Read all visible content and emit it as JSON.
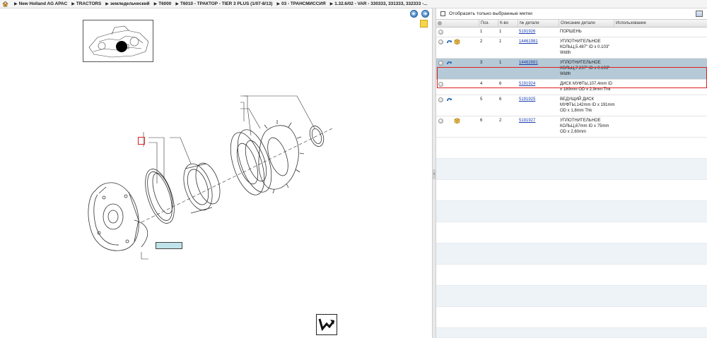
{
  "breadcrumb": [
    "New Holland AG APAC",
    "TRACTORS",
    "земледельческий",
    "T6000",
    "T6010 - ТРАКТОР - TIER 3 PLUS (1/07-8/13)",
    "03 - ТРАНСМИССИЯ",
    "1.32.6/02 - VAR - 330333, 331333, 332333 -..."
  ],
  "filter": {
    "label": "Отобразить только выбранные метки"
  },
  "table": {
    "headers": [
      "Поз.",
      "К-во",
      "№ детали",
      "Описание детали",
      "Использование"
    ],
    "rows": [
      {
        "pos": "1",
        "qty": "1",
        "part": "5191926",
        "desc": [
          "ПОРШЕНЬ"
        ],
        "blue": false,
        "box": false
      },
      {
        "pos": "2",
        "qty": "1",
        "part": "14461981",
        "desc": [
          "УПЛОТНИТЕЛЬНОЕ",
          "КОЛЬЦ,5.487\" ID x 0.103\"",
          "Width"
        ],
        "blue": true,
        "box": true
      },
      {
        "pos": "3",
        "qty": "1",
        "part": "14462681",
        "desc": [
          "УПЛОТНИТЕЛЬНОЕ",
          "КОЛЬЦ,7.237\" ID x 0.103\"",
          "Width"
        ],
        "blue": true,
        "box": false
      },
      {
        "pos": "4",
        "qty": "6",
        "part": "5191924",
        "desc": [
          "ДИСК МУФТЫ,107,4mm ID",
          "x 189mm OD x 2,9mm Thk"
        ],
        "blue": false,
        "box": false
      },
      {
        "pos": "5",
        "qty": "6",
        "part": "5191925",
        "desc": [
          "ВЕДУЩИЙ ДИСК",
          "МУФТЫ,142mm ID x 191mm",
          "OD x 1,8mm Thk"
        ],
        "blue": true,
        "box": false
      },
      {
        "pos": "6",
        "qty": "2",
        "part": "5191927",
        "desc": [
          "УПЛОТНИТЕЛЬНОЕ",
          "КОЛЬЦ,67mm ID x 75mm",
          "OD x 2,60mm"
        ],
        "blue": false,
        "box": true
      }
    ],
    "selected_index": 2
  },
  "icons": {
    "home": "home-icon",
    "prev": "arrow-left-icon",
    "next": "arrow-right-icon",
    "note": "note-icon",
    "return": "return-icon",
    "expand": "window-icon"
  },
  "colors": {
    "selection": "#b5c9d6",
    "highlight": "#e02020",
    "link": "#1a3fb0"
  }
}
